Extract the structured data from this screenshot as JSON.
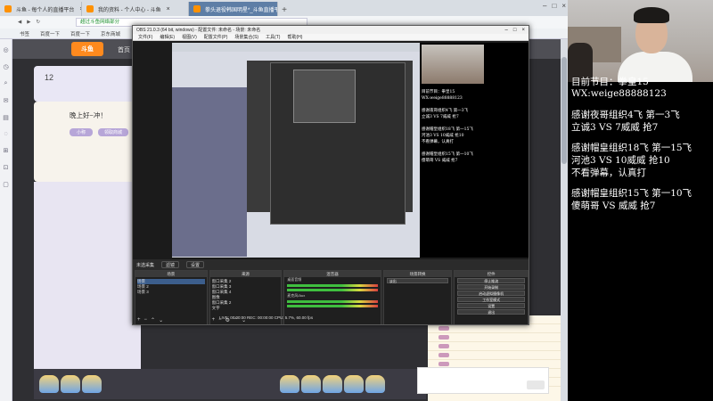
{
  "browser": {
    "tabs": [
      {
        "label": "斗鱼 - 每个人的直播平台"
      },
      {
        "label": "我的资料 - 个人中心 - 斗鱼"
      },
      {
        "label": "拳头退役韩国明星*_斗鱼直播平台",
        "active": true
      }
    ],
    "address": "超过斗鱼网络部分",
    "bookmarks": [
      "书签",
      "百度一下",
      "百度一下",
      "京东商城"
    ]
  },
  "website": {
    "logo": "斗鱼",
    "nav": "首页",
    "stat_number": "12",
    "card_title": "晚上好~冲！",
    "card_btn1": "小称",
    "card_btn2": "领取商城"
  },
  "obs": {
    "title": "OBS 21.0.3 (64 bit, windows) - 配置文件: 未命名 - 场景: 未命名",
    "menu": [
      "文件(F)",
      "编辑(E)",
      "视图(V)",
      "配置文件(P)",
      "场景集合(S)",
      "工具(T)",
      "帮助(H)"
    ],
    "scene_label": "未选采集",
    "scene_chips": [
      "滤镜",
      "设置"
    ],
    "docks": {
      "scenes": {
        "header": "场景",
        "items": [
          "场景",
          "场景 2",
          "场景 3"
        ]
      },
      "sources": {
        "header": "来源",
        "items": [
          "窗口采集 2",
          "窗口采集 3",
          "窗口采集 4",
          "图像",
          "窗口采集 2",
          "文字"
        ]
      },
      "mixer": {
        "header": "混音器",
        "labels": [
          "桌面音频",
          "麦克风/Aux"
        ]
      },
      "transitions": {
        "header": "场景转换",
        "value": "淡出"
      },
      "controls": {
        "header": "控件",
        "buttons": [
          "停止推流",
          "开始录制",
          "启动虚拟摄像机",
          "工作室模式",
          "设置",
          "退出"
        ]
      }
    },
    "status": "LIVE: 00:00:00   REC: 00:00:00   CPU: 5.7%, 60.00 fps"
  },
  "overlay": {
    "lines": [
      "目前节目：拳皇15",
      "WX:weige88888123",
      "",
      "感谢夜哥组织4飞 第一3飞",
      "立诚3 VS 7威威 抢7",
      "",
      "感谢帽皇组织18飞 第一15飞",
      "河池3 VS 10威威 抢10",
      "不看弹幕，认真打",
      "",
      "感谢帽皇组织15飞 第一10飞",
      "傻萌哥 VS 威威 抢7"
    ]
  },
  "preview_overlay_lines": [
    "目前节目：拳皇15",
    "WX:weige88888123",
    "",
    "感谢夜哥组织4飞 第一3飞",
    "立诚3 VS 7威威 抢7",
    "",
    "感谢帽皇组织18飞 第一15飞",
    "河池3 VS 10威威 抢10",
    "不看弹幕，认真打",
    "",
    "感谢帽皇组织15飞 第一10飞",
    "傻萌哥 VS 威威 抢7"
  ]
}
